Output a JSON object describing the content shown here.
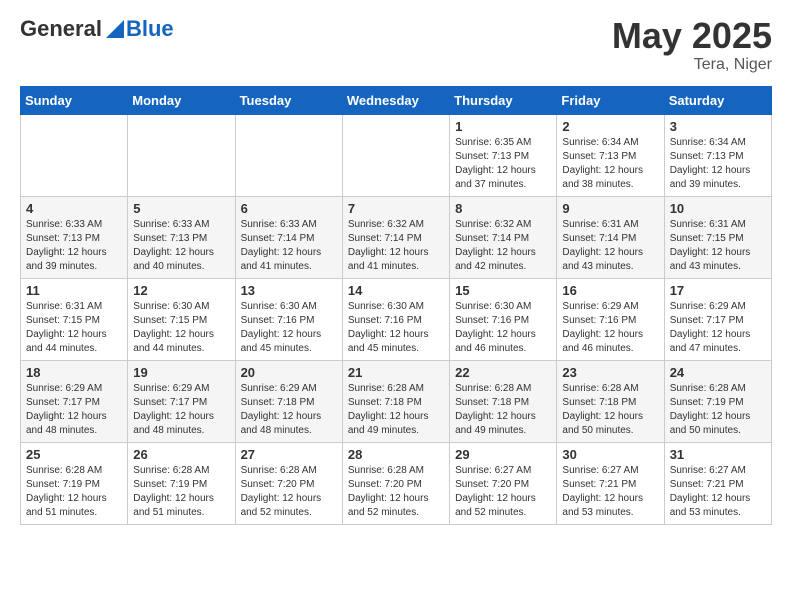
{
  "logo": {
    "general": "General",
    "blue": "Blue"
  },
  "header": {
    "month": "May 2025",
    "location": "Tera, Niger"
  },
  "weekdays": [
    "Sunday",
    "Monday",
    "Tuesday",
    "Wednesday",
    "Thursday",
    "Friday",
    "Saturday"
  ],
  "weeks": [
    [
      {
        "day": "",
        "info": ""
      },
      {
        "day": "",
        "info": ""
      },
      {
        "day": "",
        "info": ""
      },
      {
        "day": "",
        "info": ""
      },
      {
        "day": "1",
        "info": "Sunrise: 6:35 AM\nSunset: 7:13 PM\nDaylight: 12 hours and 37 minutes."
      },
      {
        "day": "2",
        "info": "Sunrise: 6:34 AM\nSunset: 7:13 PM\nDaylight: 12 hours and 38 minutes."
      },
      {
        "day": "3",
        "info": "Sunrise: 6:34 AM\nSunset: 7:13 PM\nDaylight: 12 hours and 39 minutes."
      }
    ],
    [
      {
        "day": "4",
        "info": "Sunrise: 6:33 AM\nSunset: 7:13 PM\nDaylight: 12 hours and 39 minutes."
      },
      {
        "day": "5",
        "info": "Sunrise: 6:33 AM\nSunset: 7:13 PM\nDaylight: 12 hours and 40 minutes."
      },
      {
        "day": "6",
        "info": "Sunrise: 6:33 AM\nSunset: 7:14 PM\nDaylight: 12 hours and 41 minutes."
      },
      {
        "day": "7",
        "info": "Sunrise: 6:32 AM\nSunset: 7:14 PM\nDaylight: 12 hours and 41 minutes."
      },
      {
        "day": "8",
        "info": "Sunrise: 6:32 AM\nSunset: 7:14 PM\nDaylight: 12 hours and 42 minutes."
      },
      {
        "day": "9",
        "info": "Sunrise: 6:31 AM\nSunset: 7:14 PM\nDaylight: 12 hours and 43 minutes."
      },
      {
        "day": "10",
        "info": "Sunrise: 6:31 AM\nSunset: 7:15 PM\nDaylight: 12 hours and 43 minutes."
      }
    ],
    [
      {
        "day": "11",
        "info": "Sunrise: 6:31 AM\nSunset: 7:15 PM\nDaylight: 12 hours and 44 minutes."
      },
      {
        "day": "12",
        "info": "Sunrise: 6:30 AM\nSunset: 7:15 PM\nDaylight: 12 hours and 44 minutes."
      },
      {
        "day": "13",
        "info": "Sunrise: 6:30 AM\nSunset: 7:16 PM\nDaylight: 12 hours and 45 minutes."
      },
      {
        "day": "14",
        "info": "Sunrise: 6:30 AM\nSunset: 7:16 PM\nDaylight: 12 hours and 45 minutes."
      },
      {
        "day": "15",
        "info": "Sunrise: 6:30 AM\nSunset: 7:16 PM\nDaylight: 12 hours and 46 minutes."
      },
      {
        "day": "16",
        "info": "Sunrise: 6:29 AM\nSunset: 7:16 PM\nDaylight: 12 hours and 46 minutes."
      },
      {
        "day": "17",
        "info": "Sunrise: 6:29 AM\nSunset: 7:17 PM\nDaylight: 12 hours and 47 minutes."
      }
    ],
    [
      {
        "day": "18",
        "info": "Sunrise: 6:29 AM\nSunset: 7:17 PM\nDaylight: 12 hours and 48 minutes."
      },
      {
        "day": "19",
        "info": "Sunrise: 6:29 AM\nSunset: 7:17 PM\nDaylight: 12 hours and 48 minutes."
      },
      {
        "day": "20",
        "info": "Sunrise: 6:29 AM\nSunset: 7:18 PM\nDaylight: 12 hours and 48 minutes."
      },
      {
        "day": "21",
        "info": "Sunrise: 6:28 AM\nSunset: 7:18 PM\nDaylight: 12 hours and 49 minutes."
      },
      {
        "day": "22",
        "info": "Sunrise: 6:28 AM\nSunset: 7:18 PM\nDaylight: 12 hours and 49 minutes."
      },
      {
        "day": "23",
        "info": "Sunrise: 6:28 AM\nSunset: 7:18 PM\nDaylight: 12 hours and 50 minutes."
      },
      {
        "day": "24",
        "info": "Sunrise: 6:28 AM\nSunset: 7:19 PM\nDaylight: 12 hours and 50 minutes."
      }
    ],
    [
      {
        "day": "25",
        "info": "Sunrise: 6:28 AM\nSunset: 7:19 PM\nDaylight: 12 hours and 51 minutes."
      },
      {
        "day": "26",
        "info": "Sunrise: 6:28 AM\nSunset: 7:19 PM\nDaylight: 12 hours and 51 minutes."
      },
      {
        "day": "27",
        "info": "Sunrise: 6:28 AM\nSunset: 7:20 PM\nDaylight: 12 hours and 52 minutes."
      },
      {
        "day": "28",
        "info": "Sunrise: 6:28 AM\nSunset: 7:20 PM\nDaylight: 12 hours and 52 minutes."
      },
      {
        "day": "29",
        "info": "Sunrise: 6:27 AM\nSunset: 7:20 PM\nDaylight: 12 hours and 52 minutes."
      },
      {
        "day": "30",
        "info": "Sunrise: 6:27 AM\nSunset: 7:21 PM\nDaylight: 12 hours and 53 minutes."
      },
      {
        "day": "31",
        "info": "Sunrise: 6:27 AM\nSunset: 7:21 PM\nDaylight: 12 hours and 53 minutes."
      }
    ]
  ]
}
